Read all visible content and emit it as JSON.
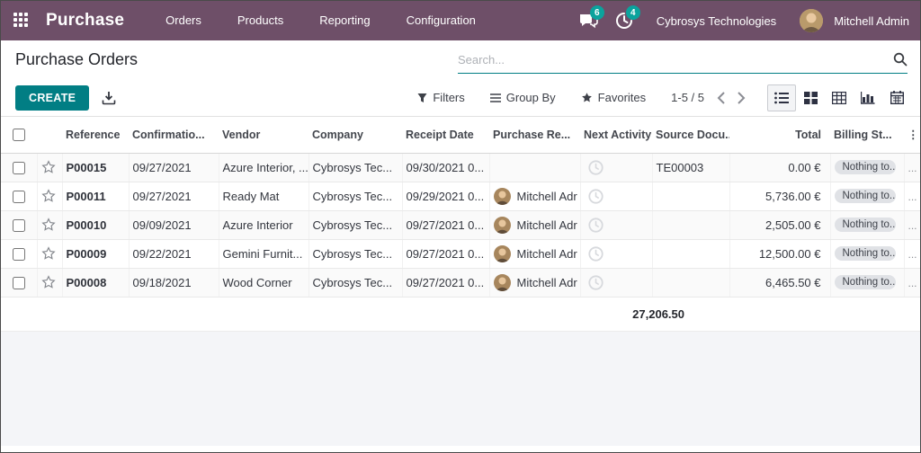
{
  "colors": {
    "topbar": "#6e4f68",
    "accent": "#017e84",
    "badge": "#0ba39d"
  },
  "topbar": {
    "app_name": "Purchase",
    "menus": [
      {
        "label": "Orders"
      },
      {
        "label": "Products"
      },
      {
        "label": "Reporting"
      },
      {
        "label": "Configuration"
      }
    ],
    "messages_badge": "6",
    "activities_badge": "4",
    "company": "Cybrosys Technologies",
    "user": "Mitchell Admin"
  },
  "control_panel": {
    "title": "Purchase Orders",
    "search_placeholder": "Search...",
    "create_label": "CREATE",
    "filters_label": "Filters",
    "group_by_label": "Group By",
    "favorites_label": "Favorites",
    "pager": "1-5 / 5",
    "dots_menu": "⋮"
  },
  "table": {
    "headers": [
      "Reference",
      "Confirmatio...",
      "Vendor",
      "Company",
      "Receipt Date",
      "Purchase Re...",
      "Next Activity",
      "Source Docu...",
      "Total",
      "Billing St..."
    ],
    "rows": [
      {
        "reference": "P00015",
        "confirmation_date": "09/27/2021",
        "vendor": "Azure Interior, ...",
        "company": "Cybrosys Tec...",
        "receipt_date": "09/30/2021 0...",
        "purchase_rep": "",
        "source_document": "TE00003",
        "total": "0.00 €",
        "billing_status": "Nothing to...",
        "trailing": "..."
      },
      {
        "reference": "P00011",
        "confirmation_date": "09/27/2021",
        "vendor": "Ready Mat",
        "company": "Cybrosys Tec...",
        "receipt_date": "09/29/2021 0...",
        "purchase_rep": "Mitchell Adr",
        "source_document": "",
        "total": "5,736.00 €",
        "billing_status": "Nothing to...",
        "trailing": "..."
      },
      {
        "reference": "P00010",
        "confirmation_date": "09/09/2021",
        "vendor": "Azure Interior",
        "company": "Cybrosys Tec...",
        "receipt_date": "09/27/2021 0...",
        "purchase_rep": "Mitchell Adr",
        "source_document": "",
        "total": "2,505.00 €",
        "billing_status": "Nothing to...",
        "trailing": "..."
      },
      {
        "reference": "P00009",
        "confirmation_date": "09/22/2021",
        "vendor": "Gemini Furnit...",
        "company": "Cybrosys Tec...",
        "receipt_date": "09/27/2021 0...",
        "purchase_rep": "Mitchell Adr",
        "source_document": "",
        "total": "12,500.00 €",
        "billing_status": "Nothing to...",
        "trailing": "..."
      },
      {
        "reference": "P00008",
        "confirmation_date": "09/18/2021",
        "vendor": "Wood Corner",
        "company": "Cybrosys Tec...",
        "receipt_date": "09/27/2021 0...",
        "purchase_rep": "Mitchell Adr",
        "source_document": "",
        "total": "6,465.50 €",
        "billing_status": "Nothing to...",
        "trailing": "..."
      }
    ],
    "total_sum": "27,206.50"
  }
}
